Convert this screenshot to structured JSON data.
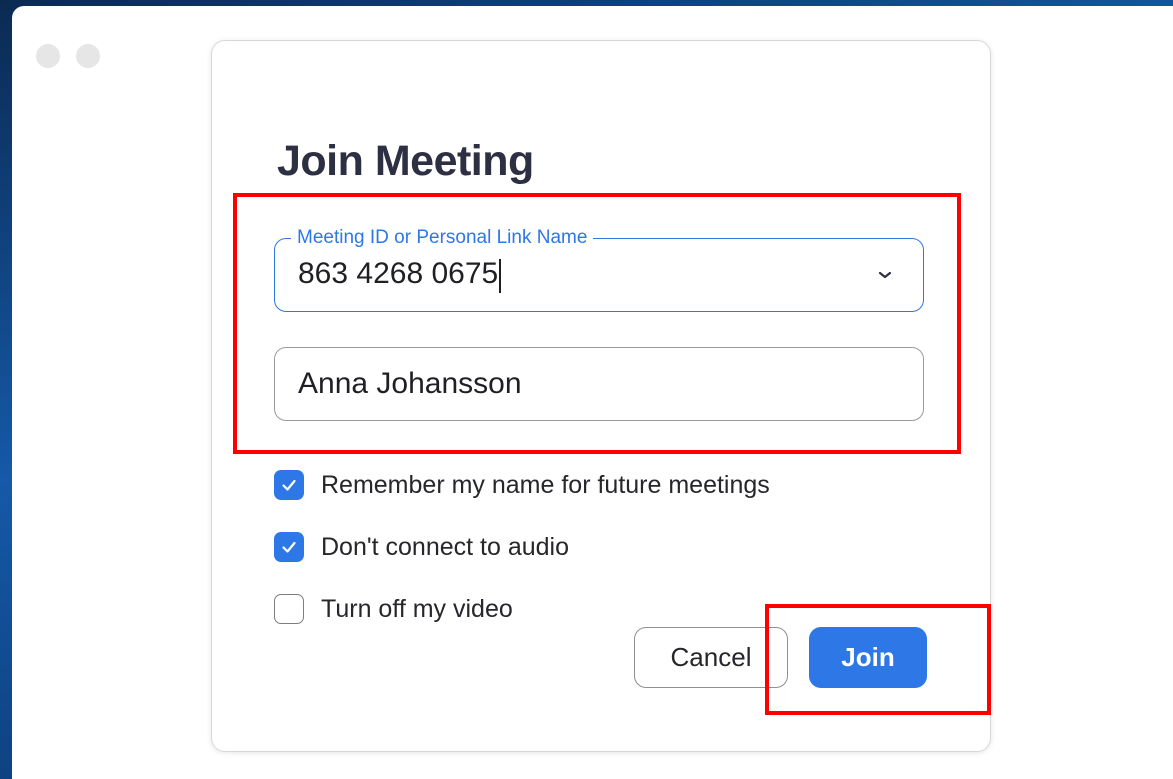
{
  "dialog": {
    "title": "Join Meeting",
    "meeting_field": {
      "label": "Meeting ID or Personal Link Name",
      "value": "863 4268 0675",
      "dropdown_icon": "chevron-down-icon"
    },
    "name_field": {
      "value": "Anna Johansson"
    },
    "options": [
      {
        "label": "Remember my name for future meetings",
        "checked": true
      },
      {
        "label": "Don't connect to audio",
        "checked": true
      },
      {
        "label": "Turn off my video",
        "checked": false
      }
    ],
    "buttons": {
      "cancel": "Cancel",
      "join": "Join"
    }
  },
  "colors": {
    "accent": "#2d78e6",
    "title": "#2d2f42",
    "highlight": "#ff0000"
  }
}
